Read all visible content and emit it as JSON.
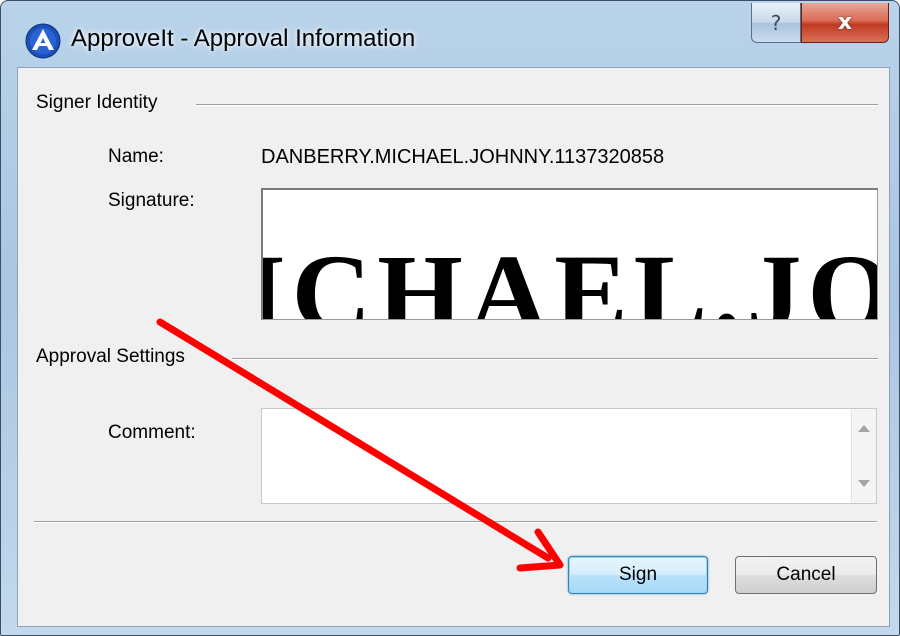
{
  "window": {
    "title": "ApproveIt - Approval Information",
    "help_glyph": "?",
    "close_glyph": "x"
  },
  "signer_identity": {
    "group_label": "Signer Identity",
    "name_label": "Name:",
    "name_value": "DANBERRY.MICHAEL.JOHNNY.1137320858",
    "signature_label": "Signature:",
    "signature_image_text": "ICHAEL.JOHN"
  },
  "approval_settings": {
    "group_label": "Approval Settings",
    "comment_label": "Comment:",
    "comment_value": ""
  },
  "buttons": {
    "sign_label": "Sign",
    "cancel_label": "Cancel"
  },
  "colors": {
    "annotation_arrow": "#ff0000",
    "close_button": "#c13a22",
    "sign_button_border": "#3c7fb1"
  },
  "icons": [
    "approveit-logo-icon",
    "help-icon",
    "close-icon",
    "scroll-up-icon",
    "scroll-down-icon",
    "annotation-arrow-icon"
  ]
}
